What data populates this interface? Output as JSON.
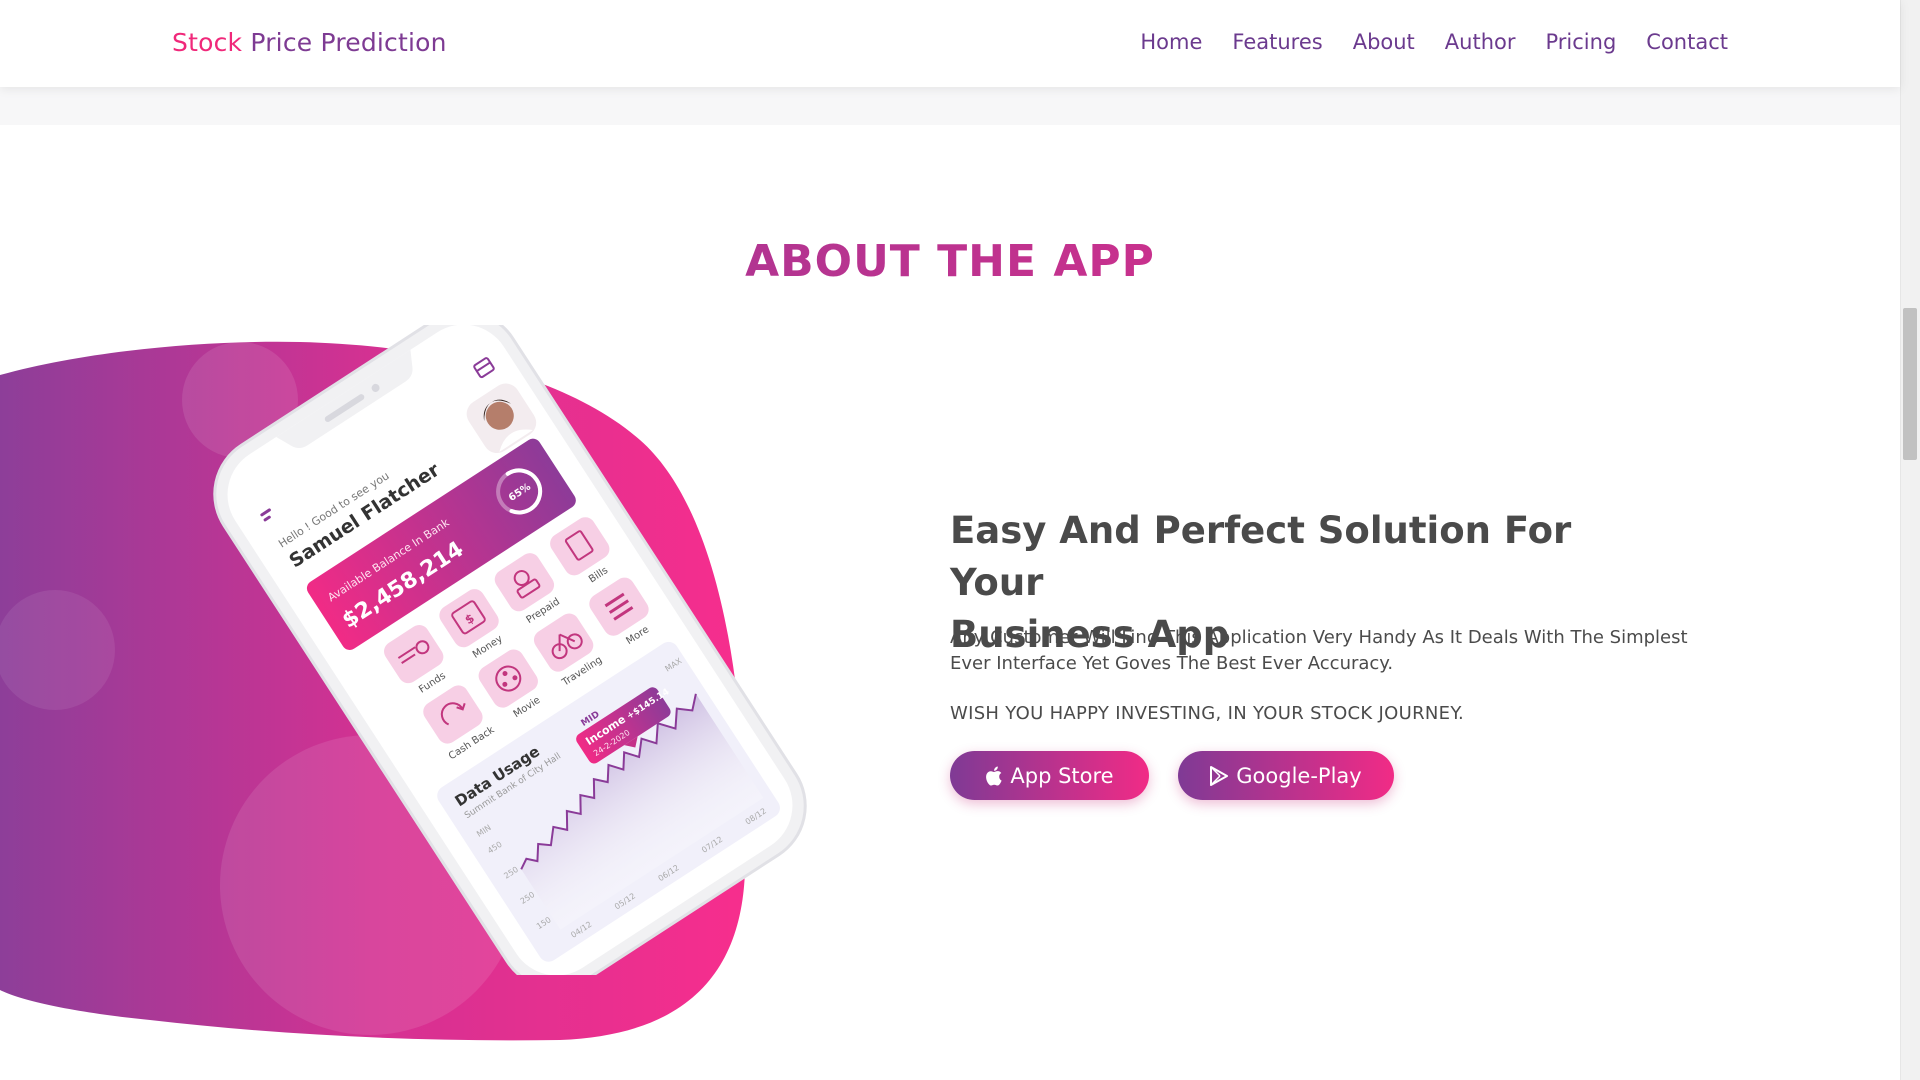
{
  "navbar": {
    "brand_first": "Stock",
    "brand_rest": "Price Prediction",
    "links": [
      "Home",
      "Features",
      "About",
      "Author",
      "Pricing",
      "Contact"
    ]
  },
  "section": {
    "title": "ABOUT THE APP"
  },
  "phone": {
    "greeting": "Hello ! Good to see you",
    "user_name": "Samuel Flatcher",
    "balance_label": "Available Balance In Bank",
    "balance_value": "$2,458,214",
    "progress_label": "65%",
    "progress_value": 0.65,
    "actions": [
      "Bills",
      "Prepaid",
      "Money",
      "Funds",
      "More",
      "Traveling",
      "Movie",
      "Cash Back"
    ],
    "chart_title": "Data Usage",
    "chart_subtitle": "Summit Bank of City Hall",
    "chart_tabs": [
      "MIN",
      "MID",
      "MAX"
    ],
    "tooltip_label": "Income",
    "tooltip_value": "+$145.14",
    "tooltip_date": "24-2-2020",
    "y_ticks": [
      "450",
      "250",
      "250",
      "150"
    ],
    "x_ticks": [
      "04/12",
      "05/12",
      "06/12",
      "07/12",
      "08/12"
    ]
  },
  "content": {
    "headline_line1": "Easy And Perfect Solution For Your",
    "headline_line2": "Business App",
    "description": "Any Customer Will Find This Application Very Handy As It Deals With The Simplest Ever Interface Yet Goves The Best Ever Accuracy.",
    "tagline": "WISH YOU HAPPY INVESTING, IN YOUR STOCK JOURNEY."
  },
  "buttons": {
    "app_store": "App Store",
    "google_play": "Google-Play"
  },
  "colors": {
    "pink": "#f0287a",
    "purple": "#7e3b93",
    "heading_gray": "#4a4a4a"
  },
  "icons": [
    "apple-icon",
    "play-icon",
    "calendar-icon",
    "menu-icon"
  ]
}
